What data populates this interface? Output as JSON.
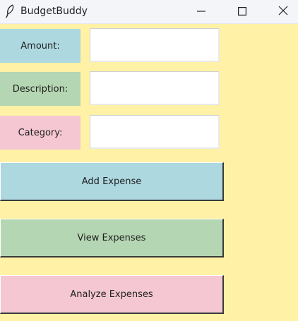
{
  "window": {
    "title": "BudgetBuddy",
    "icon": "feather-icon",
    "controls": [
      "minimize-icon",
      "maximize-icon",
      "close-icon"
    ]
  },
  "form": {
    "amount": {
      "label": "Amount:",
      "value": "",
      "color": "#add8e0"
    },
    "description": {
      "label": "Description:",
      "value": "",
      "color": "#b5d6b2"
    },
    "category": {
      "label": "Category:",
      "value": "",
      "color": "#f4c7d3"
    }
  },
  "buttons": {
    "add": {
      "label": "Add Expense",
      "color": "#add8e0"
    },
    "view": {
      "label": "View Expenses",
      "color": "#b5d6b2"
    },
    "analyze": {
      "label": "Analyze Expenses",
      "color": "#f4c7d3"
    }
  },
  "theme": {
    "background": "#fff1a6"
  }
}
